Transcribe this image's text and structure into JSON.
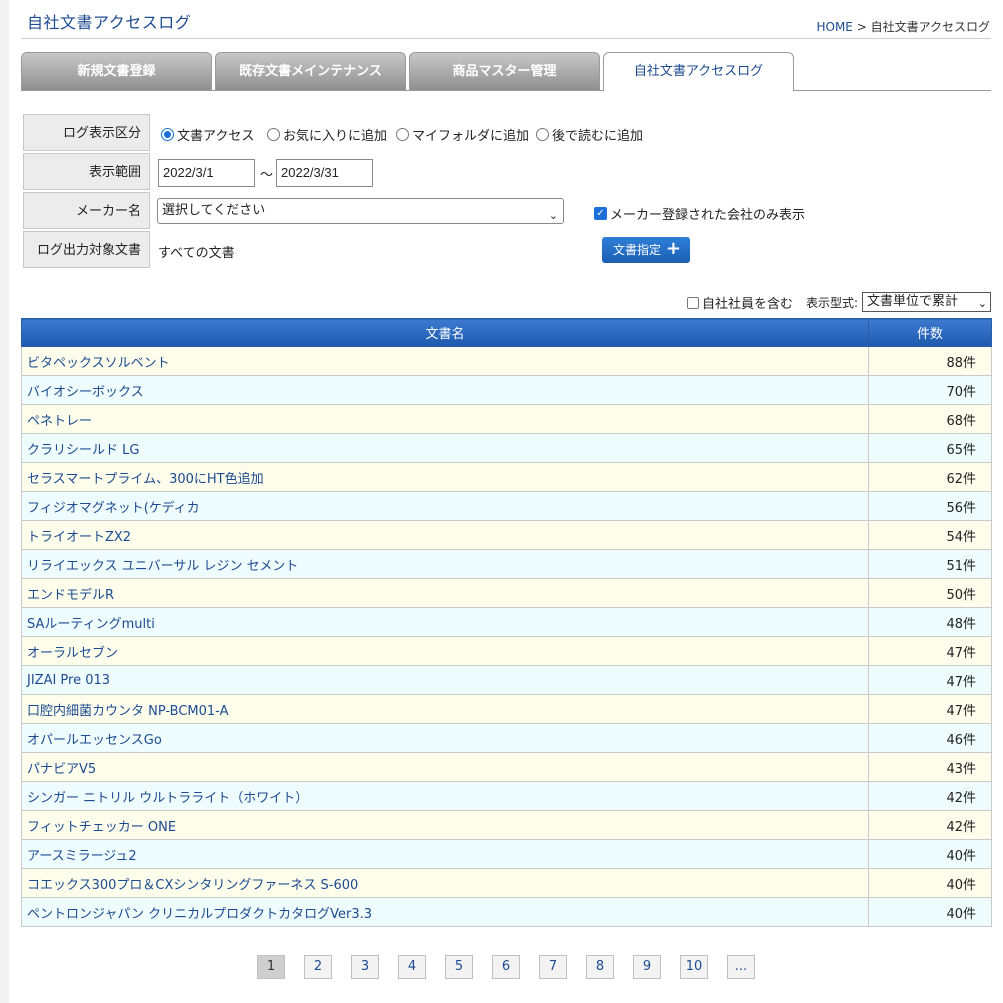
{
  "header": {
    "title": "自社文書アクセスログ",
    "breadcrumb_home": "HOME",
    "breadcrumb_sep": ">",
    "breadcrumb_current": "自社文書アクセスログ"
  },
  "tabs": [
    {
      "label": "新規文書登録",
      "active": false
    },
    {
      "label": "既存文書メインテナンス",
      "active": false
    },
    {
      "label": "商品マスター管理",
      "active": false
    },
    {
      "label": "自社文書アクセスログ",
      "active": true
    }
  ],
  "form": {
    "log_type_label": "ログ表示区分",
    "log_types": [
      {
        "label": "文書アクセス",
        "selected": true
      },
      {
        "label": "お気に入りに追加",
        "selected": false
      },
      {
        "label": "マイフォルダに追加",
        "selected": false
      },
      {
        "label": "後で読むに追加",
        "selected": false
      }
    ],
    "range_label": "表示範囲",
    "range_from": "2022/3/1",
    "range_sep": "〜",
    "range_to": "2022/3/31",
    "maker_label": "メーカー名",
    "maker_selected": "選択してください",
    "maker_only_label": "メーカー登録された会社のみ表示",
    "maker_only_checked": true,
    "docs_label": "ログ出力対象文書",
    "docs_value": "すべての文書",
    "docs_button_label": "文書指定"
  },
  "options": {
    "include_staff_label": "自社社員を含む",
    "include_staff_checked": false,
    "format_label": "表示型式:",
    "format_selected": "文書単位で累計"
  },
  "table": {
    "headers": {
      "name": "文書名",
      "count": "件数"
    },
    "rows": [
      {
        "name": "ビタペックスソルベント",
        "count": "88件"
      },
      {
        "name": "バイオシーボックス",
        "count": "70件"
      },
      {
        "name": "ペネトレー",
        "count": "68件"
      },
      {
        "name": "クラリシールド LG",
        "count": "65件"
      },
      {
        "name": "セラスマートプライム、300にHT色追加",
        "count": "62件"
      },
      {
        "name": "フィジオマグネット(ケディカ",
        "count": "56件"
      },
      {
        "name": "トライオートZX2",
        "count": "54件"
      },
      {
        "name": "リライエックス ユニバーサル レジン セメント",
        "count": "51件"
      },
      {
        "name": "エンドモデルR",
        "count": "50件"
      },
      {
        "name": "SAルーティングmulti",
        "count": "48件"
      },
      {
        "name": "オーラルセブン",
        "count": "47件"
      },
      {
        "name": "JIZAI Pre 013",
        "count": "47件"
      },
      {
        "name": "口腔内細菌カウンタ NP-BCM01-A",
        "count": "47件"
      },
      {
        "name": "オパールエッセンスGo",
        "count": "46件"
      },
      {
        "name": "パナビアV5",
        "count": "43件"
      },
      {
        "name": "シンガー ニトリル ウルトラライト（ホワイト）",
        "count": "42件"
      },
      {
        "name": "フィットチェッカー ONE",
        "count": "42件"
      },
      {
        "name": "アースミラージュ2",
        "count": "40件"
      },
      {
        "name": "コエックス300プロ＆CXシンタリングファーネス S-600",
        "count": "40件"
      },
      {
        "name": "ペントロンジャパン クリニカルプロダクトカタログVer3.3",
        "count": "40件"
      }
    ]
  },
  "pagination": {
    "pages": [
      "1",
      "2",
      "3",
      "4",
      "5",
      "6",
      "7",
      "8",
      "9",
      "10",
      "..."
    ],
    "current": "1"
  }
}
